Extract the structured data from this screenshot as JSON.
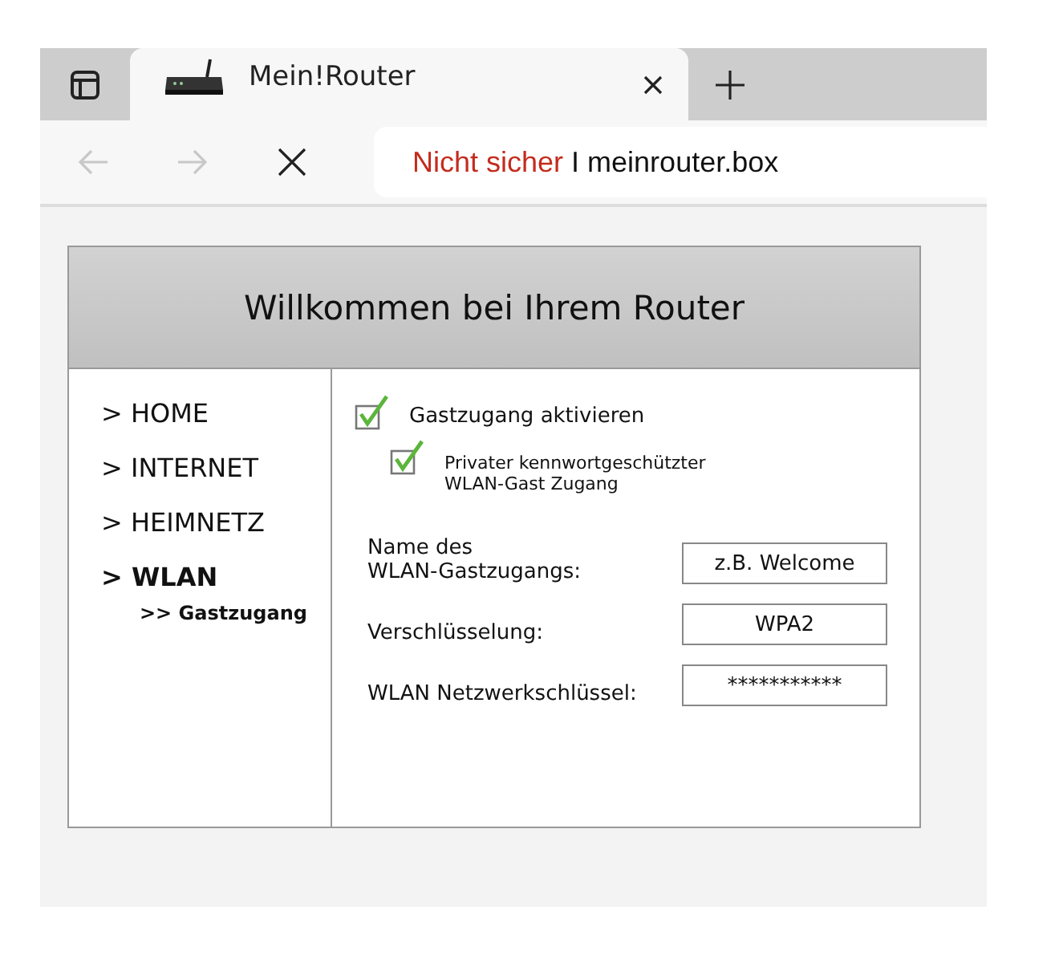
{
  "browser": {
    "tab": {
      "title": "Mein!Router",
      "selected": true
    },
    "address": {
      "warning": "Nicht sicher",
      "separator": "I",
      "url": "meinrouter.box"
    }
  },
  "page": {
    "title": "Willkommen bei Ihrem Router",
    "nav": [
      {
        "label": "> HOME",
        "selected": false
      },
      {
        "label": "> INTERNET",
        "selected": false
      },
      {
        "label": "> HEIMNETZ",
        "selected": false
      },
      {
        "label": "> WLAN",
        "selected": true,
        "children": [
          {
            "label": ">> Gastzugang",
            "selected": true
          }
        ]
      }
    ],
    "options": [
      {
        "label": "Gastzugang aktivieren",
        "checked": true
      },
      {
        "label": "Privater kennwortgeschützter\nWLAN-Gast Zugang",
        "checked": true
      }
    ],
    "fields": [
      {
        "label": "Name des\nWLAN-Gastzugangs:",
        "placeholder": "z.B. Welcome"
      },
      {
        "label": "Verschlüsselung:",
        "value": "WPA2"
      },
      {
        "label": "WLAN Netzwerkschlüssel:",
        "value": "***********"
      }
    ]
  }
}
